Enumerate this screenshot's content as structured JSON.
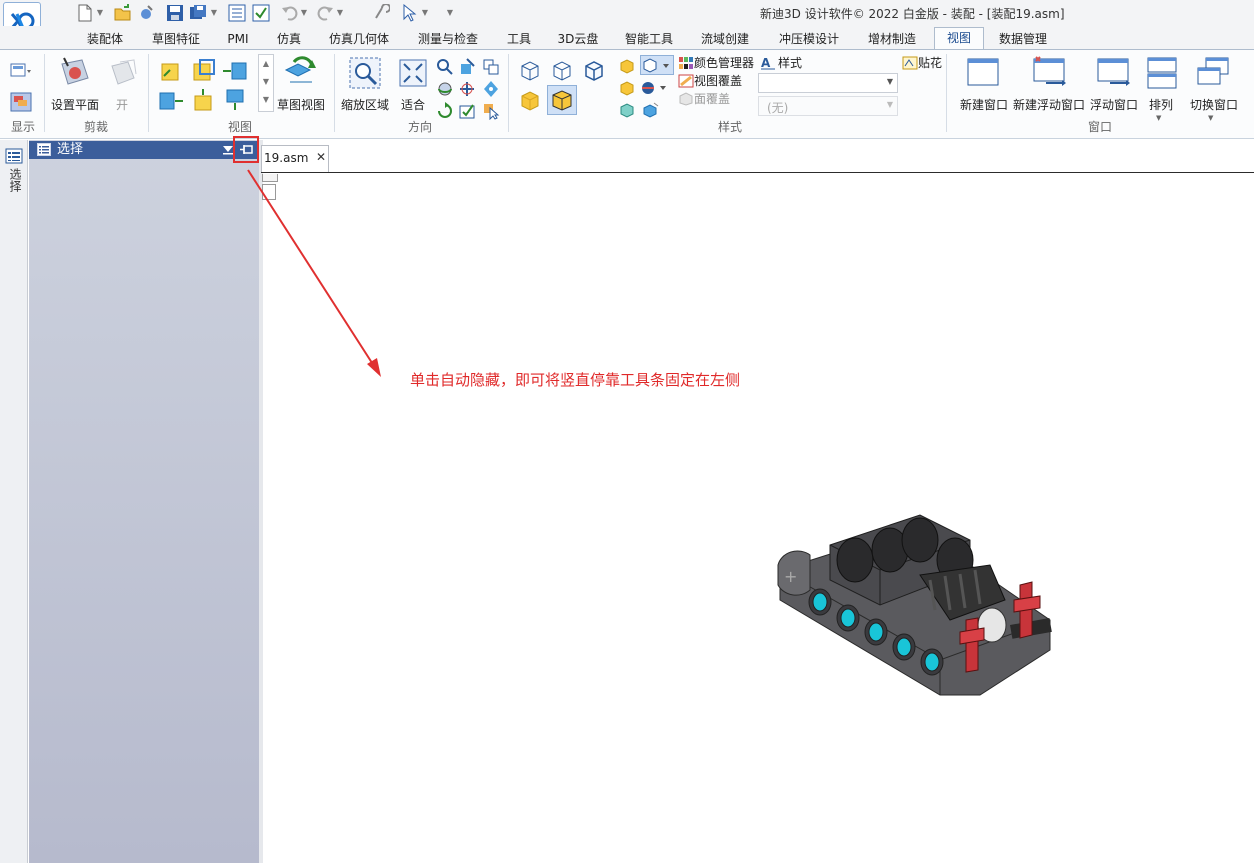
{
  "window": {
    "title": "新迪3D 设计软件© 2022 白金版 - 装配 - [装配19.asm]"
  },
  "tabs": [
    "装配体",
    "草图特征",
    "PMI",
    "仿真",
    "仿真几何体",
    "测量与检查",
    "工具",
    "3D云盘",
    "智能工具",
    "流域创建",
    "冲压模设计",
    "增材制造",
    "视图",
    "数据管理"
  ],
  "active_tab": "视图",
  "ribbon": {
    "display_group": "显示",
    "clip_group": "剪裁",
    "set_plane_label": "设置平面",
    "open_label": "开",
    "view_group": "视图",
    "sketch_view_label": "草图视图",
    "zoom_area_label": "缩放区域",
    "fit_label": "适合",
    "direction_group": "方向",
    "style_group": "样式",
    "color_manager_label": "颜色管理器",
    "view_overlay_label": "视图覆盖",
    "face_overlay_label": "面覆盖",
    "style_label": "样式",
    "style_dropdown_value": "",
    "style_dropdown2_value": "(无)",
    "decal_label": "贴花",
    "window_group": "窗口",
    "new_window_label": "新建窗口",
    "new_float_window_label": "新建浮动窗口",
    "float_window_label": "浮动窗口",
    "arrange_label": "排列",
    "switch_window_label": "切换窗口"
  },
  "sidebar": {
    "vertical_tab_label": "选择"
  },
  "panel": {
    "title": "选择"
  },
  "document": {
    "tab_label": "19.asm",
    "close_glyph": "✕"
  },
  "annotation": {
    "text": "单击自动隐藏，即可将竖直停靠工具条固定在左侧",
    "color": "#e02a2a"
  },
  "colors": {
    "panel_header": "#3b5e9b",
    "panel_bg": "#c3c7d6",
    "accent": "#1b4b8f"
  }
}
